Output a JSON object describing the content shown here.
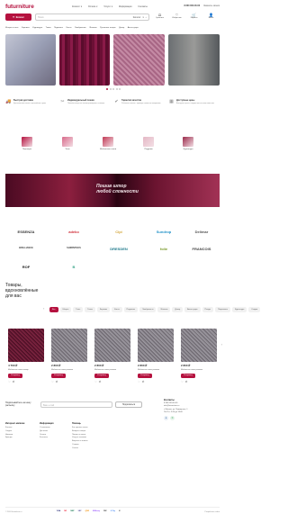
{
  "header": {
    "logo": "futurniture",
    "nav": [
      "Каталог",
      "Оплата",
      "Услуги",
      "Информация",
      "Контакты"
    ],
    "phone": "8 800 000-00-00",
    "callback": "Заказать звонок"
  },
  "toolbar": {
    "catalog_label": "Каталог",
    "search_placeholder": "Поиск",
    "search_category": "Каталог",
    "icons": [
      {
        "name": "compare-icon",
        "label": "Сравнить",
        "glyph": "⚖"
      },
      {
        "name": "favorite-icon",
        "label": "Избранное",
        "glyph": "♡"
      },
      {
        "name": "cart-icon",
        "label": "Корзина",
        "glyph": "🛒"
      },
      {
        "name": "user-icon",
        "label": "Войти",
        "glyph": "👤"
      }
    ]
  },
  "categories_row": [
    "Шторы и тюль",
    "Карнизы",
    "Фурнитура",
    "Ткани",
    "Подхваты",
    "Кисти",
    "Ламбрекены",
    "Жалюзи",
    "Рулонные шторы",
    "Декор",
    "Аксессуары"
  ],
  "slider_dots": 5,
  "features": [
    {
      "icon": "🚚",
      "title": "Быстрая доставка",
      "desc": "Доставим ваш заказ в кратчайшие сроки"
    },
    {
      "icon": "✂",
      "title": "Индивидуальный пошив",
      "desc": "Пошьём шторы по вашим размерам и эскизам"
    },
    {
      "icon": "✔",
      "title": "Гарантия качества",
      "desc": "Работаем только с проверенными поставщиками"
    },
    {
      "icon": "▦",
      "title": "Доступные цены",
      "desc": "Выгодные цены и скидки постоянным клиентам"
    }
  ],
  "category_cards": [
    {
      "label": "Портьеры",
      "color": "#b5123f"
    },
    {
      "label": "Тюль",
      "color": "#d86a8a"
    },
    {
      "label": "Мебельные ткани",
      "color": "#c23a55"
    },
    {
      "label": "Подушки",
      "color": "#e4b8c5"
    },
    {
      "label": "Фурнитура",
      "color": "#9b2a4a"
    }
  ],
  "banner": {
    "line1": "Пошив штор",
    "line2": "любой сложности"
  },
  "brands": [
    {
      "name": "ESSENZA",
      "color": "#333"
    },
    {
      "name": "adeko",
      "color": "#d0303b"
    },
    {
      "name": "Cipi",
      "color": "#d2a63a"
    },
    {
      "name": "Sundrop",
      "color": "#1e90c7"
    },
    {
      "name": "Delimar",
      "color": "#555"
    },
    {
      "name": "BRILLIANCE",
      "color": "#444"
    },
    {
      "name": "SHIRINTEKS",
      "color": "#444"
    },
    {
      "name": "DRESDEN",
      "color": "#1f7a8c"
    },
    {
      "name": "folie",
      "color": "#7a9a2a"
    },
    {
      "name": "FRANCOIS",
      "color": "#444"
    },
    {
      "name": "ROF",
      "color": "#222"
    },
    {
      "name": "B",
      "color": "#3aa68a"
    }
  ],
  "products_section": {
    "title": "Товары, вдохновлённые для вас",
    "tabs": [
      "Все",
      "Шторы",
      "Тюль",
      "Ткани",
      "Карнизы",
      "Кисти",
      "Подхваты",
      "Ламбрекены",
      "Жалюзи",
      "Декор",
      "Аксессуары",
      "Пледы",
      "Покрывала",
      "Фурнитура",
      "Скидки"
    ],
    "products": [
      {
        "price": "4 700 ₽",
        "name": "Мебельная ткань велюр",
        "buy": "В корзину"
      },
      {
        "price": "2 800 ₽",
        "name": "Мебельная ткань рогожка",
        "buy": "В корзину"
      },
      {
        "price": "2 800 ₽",
        "name": "Мебельная ткань рогожка",
        "buy": "В корзину"
      },
      {
        "price": "2 800 ₽",
        "name": "Мебельная ткань рогожка",
        "buy": "В корзину"
      },
      {
        "price": "2 800 ₽",
        "name": "Мебельная ткань рогожка",
        "buy": "В корзину"
      }
    ]
  },
  "subscribe": {
    "text": "Подписывайтесь на нашу рассылку",
    "placeholder": "Ваш e-mail",
    "button": "Подписаться"
  },
  "contacts": {
    "title": "Контакты",
    "phone": "8 800 000-00-00",
    "email": "info@futurniture.ru",
    "address": "г. Москва, ул. Примерная, 1",
    "hours": "Пн-Пт с 9:00 до 18:00"
  },
  "footer_cols": [
    {
      "title": "Интернет-магазин",
      "items": [
        "Каталог",
        "Скидки",
        "Новинки",
        "Бренды"
      ]
    },
    {
      "title": "Информация",
      "items": [
        "О компании",
        "Доставка",
        "Оплата",
        "Контакты"
      ]
    },
    {
      "title": "Помощь",
      "items": [
        "Как сделать заказ",
        "Возврат товара",
        "Пошив на заказ",
        "Уход за тканями",
        "Вопросы и ответы",
        "Отзывы",
        "Статьи"
      ]
    }
  ],
  "footer": {
    "copyright": "© 2024 futurniture.ru",
    "payments": [
      "VISA",
      "MC",
      "МИР",
      "SBP",
      "QIWI",
      "ЮMoney",
      "PAY",
      "G Pay",
      "₽"
    ],
    "made_by": "Разработка сайта"
  }
}
